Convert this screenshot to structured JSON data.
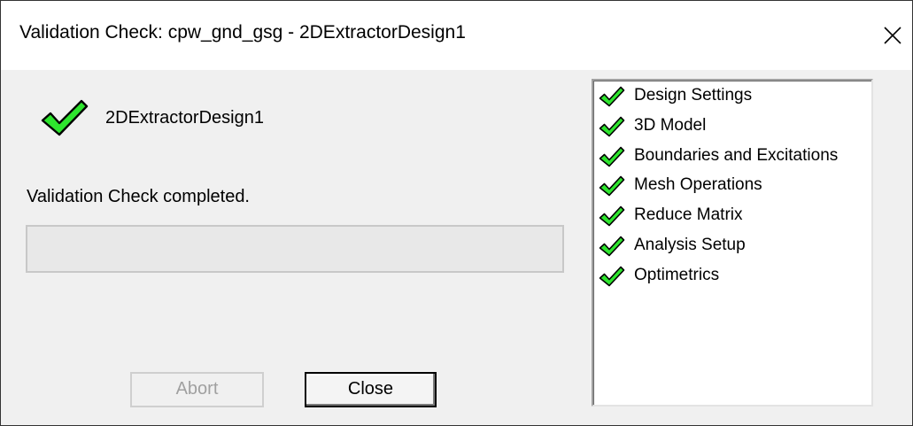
{
  "window": {
    "title": "Validation Check: cpw_gnd_gsg - 2DExtractorDesign1"
  },
  "design": {
    "name": "2DExtractorDesign1",
    "status_icon": "green-check-icon"
  },
  "status": {
    "message": "Validation Check completed.",
    "progress": 0
  },
  "buttons": {
    "abort_label": "Abort",
    "close_label": "Close"
  },
  "checks": {
    "items": [
      {
        "label": "Design Settings",
        "icon": "green-check-icon"
      },
      {
        "label": "3D Model",
        "icon": "green-check-icon"
      },
      {
        "label": "Boundaries and Excitations",
        "icon": "green-check-icon"
      },
      {
        "label": "Mesh Operations",
        "icon": "green-check-icon"
      },
      {
        "label": "Reduce Matrix",
        "icon": "green-check-icon"
      },
      {
        "label": "Analysis Setup",
        "icon": "green-check-icon"
      },
      {
        "label": "Optimetrics",
        "icon": "green-check-icon"
      }
    ]
  },
  "colors": {
    "check_fill": "#2ee52e",
    "check_outline": "#000000",
    "dialog_bg": "#f0f0f0"
  }
}
